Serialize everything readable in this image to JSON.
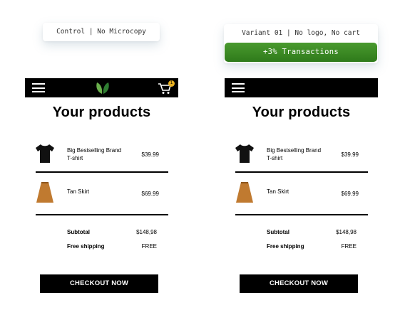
{
  "labels": {
    "control": "Control | No Microcopy",
    "variant": "Variant 01 | No logo, No cart",
    "variant_stat": "+3% Transactions"
  },
  "variants": [
    {
      "title": "Your products",
      "cart_count": "1",
      "products": [
        {
          "name": "Big Bestselling Brand T-shirt",
          "price": "$39.99",
          "icon": "tshirt-image"
        },
        {
          "name": "Tan Skirt",
          "price": "$69.99",
          "icon": "skirt-image"
        }
      ],
      "summary": {
        "subtotal_label": "Subtotal",
        "subtotal_value": "$148,98",
        "shipping_label": "Free shipping",
        "shipping_value": "FREE"
      },
      "checkout_label": "CHECKOUT NOW"
    },
    {
      "title": "Your products",
      "products": [
        {
          "name": "Big Bestselling Brand T-shirt",
          "price": "$39.99",
          "icon": "tshirt-image"
        },
        {
          "name": "Tan Skirt",
          "price": "$69.99",
          "icon": "skirt-image"
        }
      ],
      "summary": {
        "subtotal_label": "Subtotal",
        "subtotal_value": "$148,98",
        "shipping_label": "Free shipping",
        "shipping_value": "FREE"
      },
      "checkout_label": "CHECKOUT NOW"
    }
  ],
  "colors": {
    "navbar": "#000000",
    "badge_green": "#3a8a25",
    "cart_badge": "#e8b020",
    "tshirt": "#111111",
    "skirt": "#c07a30"
  }
}
